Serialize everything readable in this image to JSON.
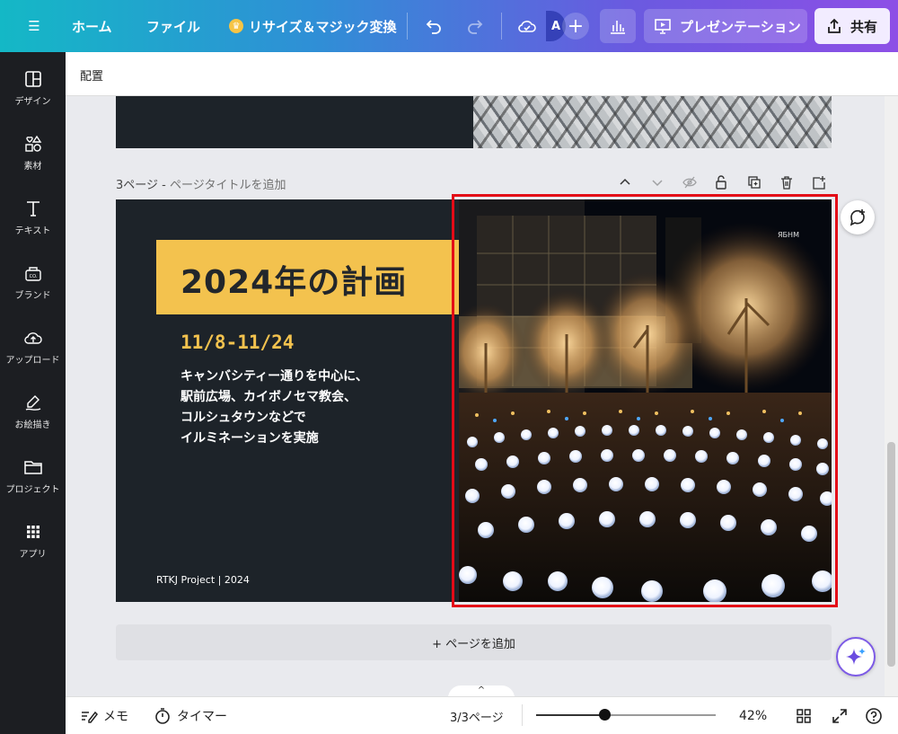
{
  "topbar": {
    "menu_icon": "hamburger-icon",
    "home": "ホーム",
    "file": "ファイル",
    "resize": "リサイズ＆マジック変換",
    "avatar_initial": "A",
    "present": "プレゼンテーション",
    "share": "共有"
  },
  "subheader": {
    "label": "配置"
  },
  "sidebar": {
    "items": [
      {
        "label": "デザイン",
        "icon": "layout-icon"
      },
      {
        "label": "素材",
        "icon": "shapes-icon"
      },
      {
        "label": "テキスト",
        "icon": "text-icon"
      },
      {
        "label": "ブランド",
        "icon": "brand-icon"
      },
      {
        "label": "アップロード",
        "icon": "cloud-upload-icon"
      },
      {
        "label": "お絵描き",
        "icon": "draw-icon"
      },
      {
        "label": "プロジェクト",
        "icon": "folder-icon"
      },
      {
        "label": "アプリ",
        "icon": "apps-icon"
      }
    ]
  },
  "page": {
    "label": "3ページ -",
    "title_placeholder": "ページタイトルを追加"
  },
  "slide": {
    "title": "2024年の計画",
    "date": "11/8-11/24",
    "description": [
      "キャンバシティー通りを中心に、",
      "駅前広場、カイボノセマ教会、",
      "コルシュタウンなどで",
      "イルミネーションを実施"
    ],
    "footer": "RTKJ Project | 2024"
  },
  "add_page": "+ ページを追加",
  "bottombar": {
    "memo": "メモ",
    "timer": "タイマー",
    "page_indicator": "3/3ページ",
    "zoom_percent": "42%",
    "zoom_level": 0.38
  },
  "colors": {
    "accent_yellow": "#f3c24e",
    "slide_bg": "#1d2329",
    "selection": "#e30b17"
  }
}
